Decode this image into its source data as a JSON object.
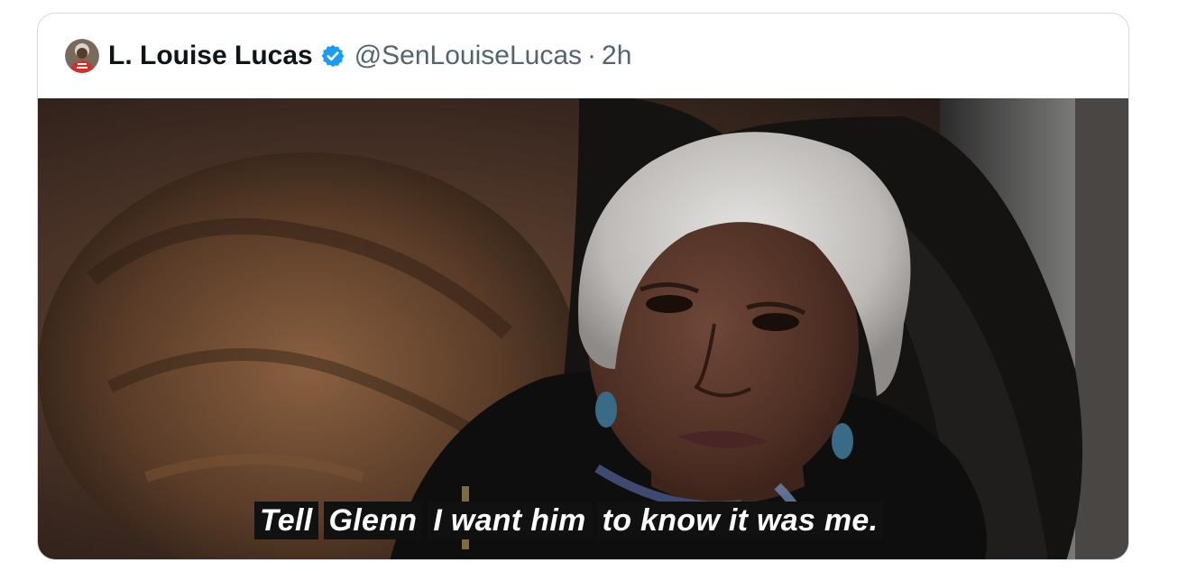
{
  "tweet": {
    "display_name": "L. Louise Lucas",
    "handle": "@SenLouiseLucas",
    "separator": "·",
    "time": "2h",
    "verified": true
  },
  "icons": {
    "avatar": "profile-photo",
    "verified": "verified-badge-icon"
  },
  "colors": {
    "verified_blue": "#1d9bf0",
    "text_primary": "#0f1419",
    "text_secondary": "#536471",
    "border": "#d6dade"
  },
  "media": {
    "subtitle_segments": [
      "Tell",
      "Glenn",
      "I want him",
      "to know it was me."
    ]
  }
}
